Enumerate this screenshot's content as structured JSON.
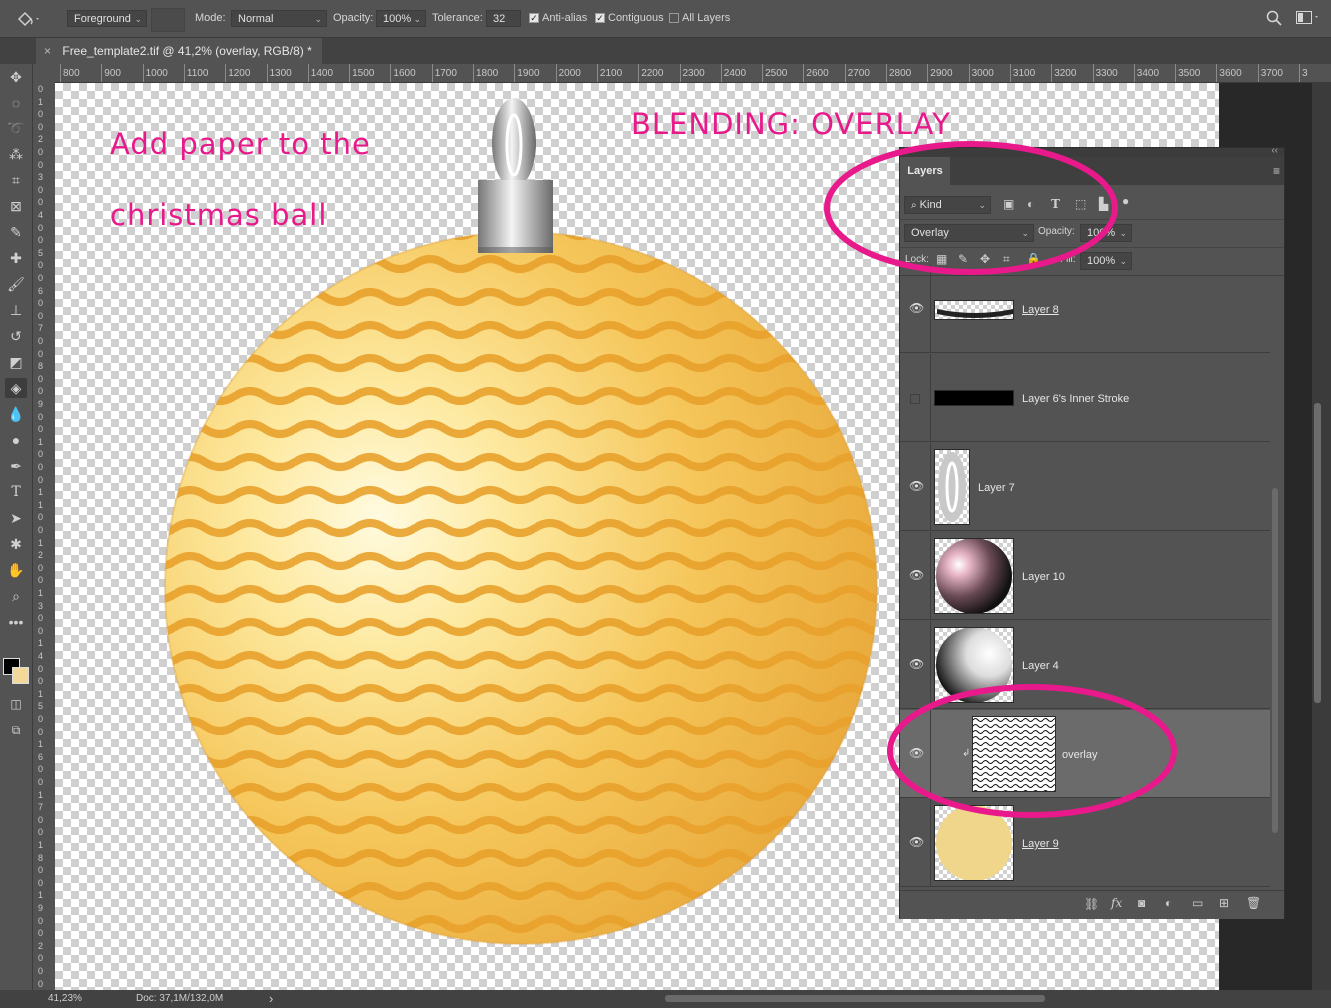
{
  "options_bar": {
    "fill_source": "Foreground",
    "mode_label": "Mode:",
    "mode_value": "Normal",
    "opacity_label": "Opacity:",
    "opacity_value": "100%",
    "tolerance_label": "Tolerance:",
    "tolerance_value": "32",
    "anti_alias_label": "Anti-alias",
    "anti_alias_checked": true,
    "contiguous_label": "Contiguous",
    "contiguous_checked": true,
    "all_layers_label": "All Layers",
    "all_layers_checked": false
  },
  "document_tab": {
    "title": "Free_template2.tif @ 41,2% (overlay, RGB/8) *",
    "close_glyph": "×"
  },
  "rulers": {
    "horizontal": [
      "800",
      "900",
      "1000",
      "1100",
      "1200",
      "1300",
      "1400",
      "1500",
      "1600",
      "1700",
      "1800",
      "1900",
      "2000",
      "2100",
      "2200",
      "2300",
      "2400",
      "2500",
      "2600",
      "2700",
      "2800",
      "2900",
      "3000",
      "3100",
      "3200",
      "3300",
      "3400",
      "3500",
      "3600",
      "3700",
      "3"
    ],
    "vertical": [
      "0",
      "1",
      "0",
      "0",
      "2",
      "0",
      "0",
      "3",
      "0",
      "0",
      "4",
      "0",
      "0",
      "5",
      "0",
      "0",
      "6",
      "0",
      "0",
      "7",
      "0",
      "0",
      "8",
      "0",
      "0",
      "9",
      "0",
      "0",
      "1",
      "0",
      "0",
      "0",
      "1",
      "1",
      "0",
      "0",
      "1",
      "2",
      "0",
      "0",
      "1",
      "3",
      "0",
      "0",
      "1",
      "4",
      "0",
      "0",
      "1",
      "5",
      "0",
      "0",
      "1",
      "6",
      "0",
      "0",
      "1",
      "7",
      "0",
      "0",
      "1",
      "8",
      "0",
      "0",
      "1",
      "9",
      "0",
      "0",
      "2",
      "0",
      "0",
      "0"
    ]
  },
  "annotations": {
    "line1": "Add paper to the",
    "line2": "christmas ball",
    "blending": "BLENDING: OVERLAY",
    "accent_color": "#e8198b"
  },
  "layers_panel": {
    "tab_label": "Layers",
    "filter_kind": "Kind",
    "blend_mode": "Overlay",
    "opacity_label": "Opacity:",
    "opacity_value": "100%",
    "lock_label": "Lock:",
    "fill_label": "Fill:",
    "fill_value": "100%",
    "layers": [
      {
        "name": "Layer 8",
        "visible": true,
        "selected": false,
        "thumb": "stroke-white"
      },
      {
        "name": "Layer 6's Inner Stroke",
        "visible": false,
        "selected": false,
        "thumb": "stroke-black"
      },
      {
        "name": "Layer 7",
        "visible": true,
        "selected": false,
        "thumb": "hanger"
      },
      {
        "name": "Layer 10",
        "visible": true,
        "selected": false,
        "thumb": "sphere-pink"
      },
      {
        "name": "Layer 4",
        "visible": true,
        "selected": false,
        "thumb": "sphere-white"
      },
      {
        "name": "overlay",
        "visible": true,
        "selected": true,
        "thumb": "waves"
      },
      {
        "name": "Layer 9",
        "visible": true,
        "selected": false,
        "thumb": "circle-yellow"
      }
    ]
  },
  "status_bar": {
    "zoom": "41,23%",
    "doc_size": "Doc: 37,1M/132,0M",
    "arrow": "›"
  }
}
